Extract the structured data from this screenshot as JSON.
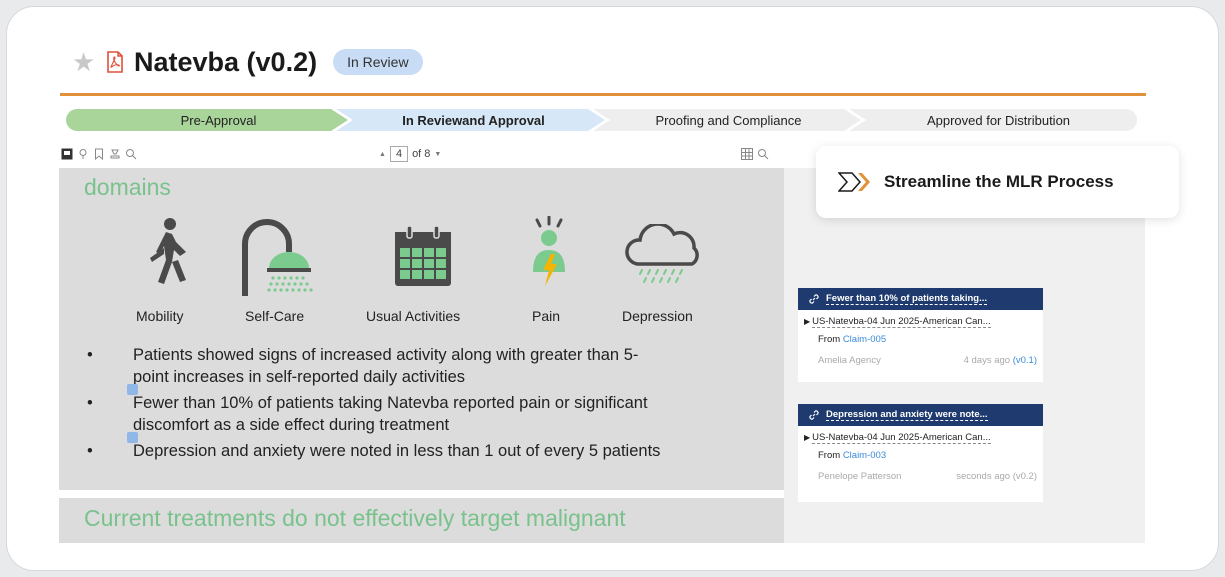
{
  "header": {
    "title": "Natevba (v0.2)",
    "status_badge": "In Review"
  },
  "stepper": {
    "steps": [
      {
        "label": "Pre-Approval",
        "state": "done"
      },
      {
        "label": "In Reviewand Approval",
        "state": "current"
      },
      {
        "label": "Proofing and Compliance",
        "state": "pending"
      },
      {
        "label": "Approved for Distribution",
        "state": "pending"
      }
    ]
  },
  "viewer": {
    "page_current": "4",
    "page_total_label": "of 8",
    "up_arrow": "▲",
    "down_arrow": "▼"
  },
  "document": {
    "heading": "domains",
    "icons": [
      {
        "label": "Mobility",
        "icon": "walking-person-icon"
      },
      {
        "label": "Self-Care",
        "icon": "shower-icon"
      },
      {
        "label": "Usual Activities",
        "icon": "calendar-icon"
      },
      {
        "label": "Pain",
        "icon": "pain-person-icon"
      },
      {
        "label": "Depression",
        "icon": "rain-cloud-icon"
      }
    ],
    "bullets": [
      {
        "line1": "Patients showed signs of increased activity along with greater than 5-",
        "line2": "point increases in self-reported  daily activities"
      },
      {
        "line1": "Fewer than 10% of patients taking Natevba reported  pain or significant",
        "line2": "discomfort  as a side effect during treatment"
      },
      {
        "line1": "Depression  and anxiety were noted in less than 1 out of every 5 patients",
        "line2": ""
      }
    ],
    "bullet_symbol": "•",
    "next_section_heading": "Current treatments do not effectively target malignant"
  },
  "callout": {
    "text": "Streamline the MLR Process"
  },
  "comments": [
    {
      "title": "Fewer than 10% of patients taking...",
      "reference": "US-Natevba-04  Jun 2025-American Can...",
      "from_label": "From",
      "claim": "Claim-005",
      "author": "Amelia Agency",
      "time": "4 days ago",
      "version": "(v0.1)"
    },
    {
      "title": "Depression and anxiety were note...",
      "reference": "US-Natevba-04  Jun 2025-American Can...",
      "from_label": "From",
      "claim": "Claim-003",
      "author": "Penelope Patterson",
      "time": "seconds ago",
      "version": "(v0.2)"
    }
  ],
  "colors": {
    "accent_orange": "#e0913a",
    "step_done": "#a9d49a",
    "step_current": "#d6e7f7",
    "step_pending": "#eeeeee",
    "icon_green": "#7ccb8e",
    "icon_gray": "#4a4a4a",
    "comment_header": "#1f3a6e",
    "heading_green": "#79c28c"
  }
}
